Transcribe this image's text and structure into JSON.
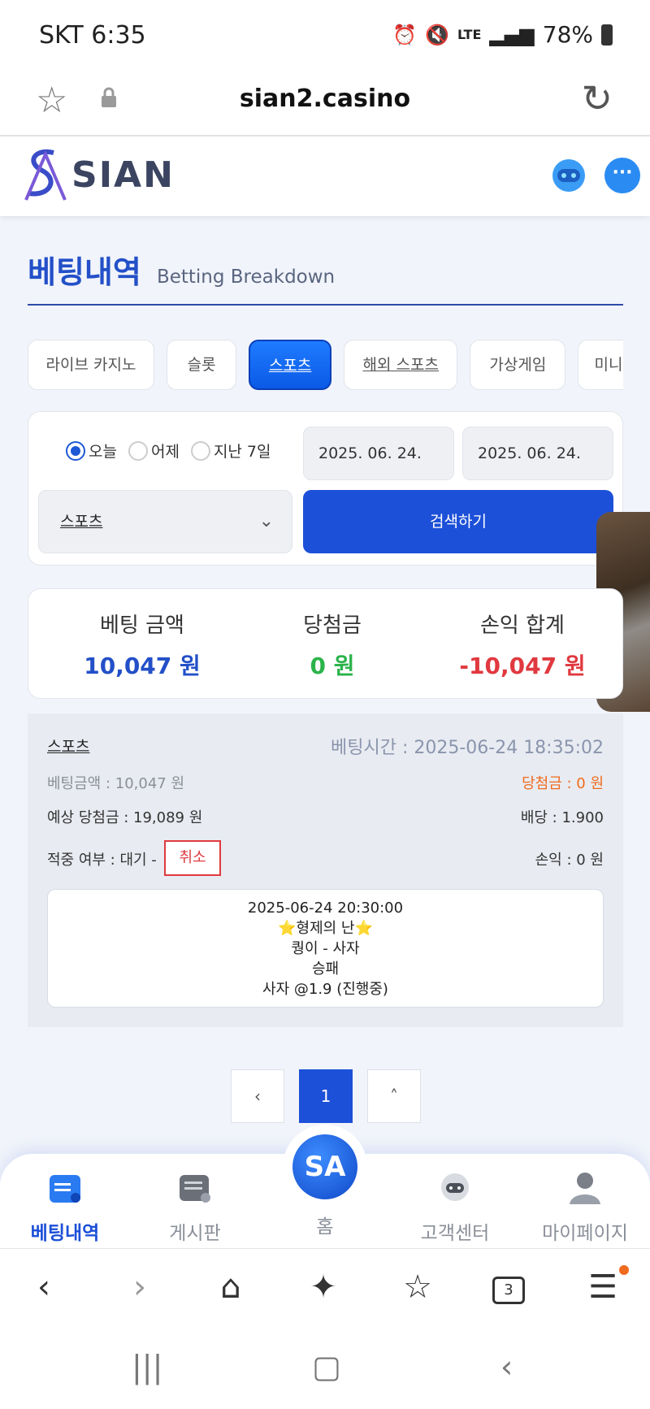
{
  "status": {
    "carrier_time": "SKT 6:35",
    "battery": "78%",
    "network": "LTE"
  },
  "browser": {
    "domain": "sian2.casino",
    "tab_count": "3"
  },
  "site": {
    "logo_text": "SIAN",
    "logo_mark": "SA"
  },
  "page": {
    "title_ko": "베팅내역",
    "title_en": "Betting Breakdown"
  },
  "tabs": [
    {
      "label": "라이브 카지노",
      "active": false
    },
    {
      "label": "슬롯",
      "active": false
    },
    {
      "label": "스포츠",
      "active": true
    },
    {
      "label": "해외 스포츠",
      "active": false
    },
    {
      "label": "가상게임",
      "active": false
    },
    {
      "label": "미니게임",
      "active": false
    }
  ],
  "filter": {
    "radios": [
      {
        "label": "오늘",
        "selected": true
      },
      {
        "label": "어제",
        "selected": false
      },
      {
        "label": "지난 7일",
        "selected": false
      }
    ],
    "date_from": "2025. 06. 24.",
    "date_to": "2025. 06. 24.",
    "category": "스포츠",
    "search_label": "검색하기"
  },
  "summary": {
    "bet_amount_label": "베팅 금액",
    "bet_amount_value": "10,047 원",
    "winnings_label": "당첨금",
    "winnings_value": "0 원",
    "profit_label": "손익 합계",
    "profit_value": "-10,047 원",
    "colors": {
      "bet": "#2350c8",
      "win": "#2bb34a",
      "loss": "#e0393f"
    }
  },
  "bet": {
    "sport": "스포츠",
    "bet_time": "베팅시간 : 2025-06-24 18:35:02",
    "bet_amount": "베팅금액 : 10,047 원",
    "winnings": "당첨금 : 0 원",
    "expected_win": "예상 당첨금 : 19,089 원",
    "odds": "배당 : 1.900",
    "hit_status": "적중 여부 : 대기 -",
    "cancel_label": "취소",
    "profit": "손익 : 0 원",
    "match": {
      "datetime": "2025-06-24 20:30:00",
      "league": "⭐형제의 난⭐",
      "teams": "퀑이 - 사자",
      "market": "승패",
      "pick": "사자 @1.9 (진행중)"
    }
  },
  "pagination": {
    "prev": "‹",
    "current": "1",
    "top": "˄"
  },
  "bottom_nav": [
    {
      "label": "베팅내역",
      "icon": "calendar-icon",
      "active": true
    },
    {
      "label": "게시판",
      "icon": "board-icon",
      "active": false
    },
    {
      "label": "홈",
      "icon": "home-logo-icon",
      "active": false
    },
    {
      "label": "고객센터",
      "icon": "support-icon",
      "active": false
    },
    {
      "label": "마이페이지",
      "icon": "user-icon",
      "active": false
    }
  ]
}
